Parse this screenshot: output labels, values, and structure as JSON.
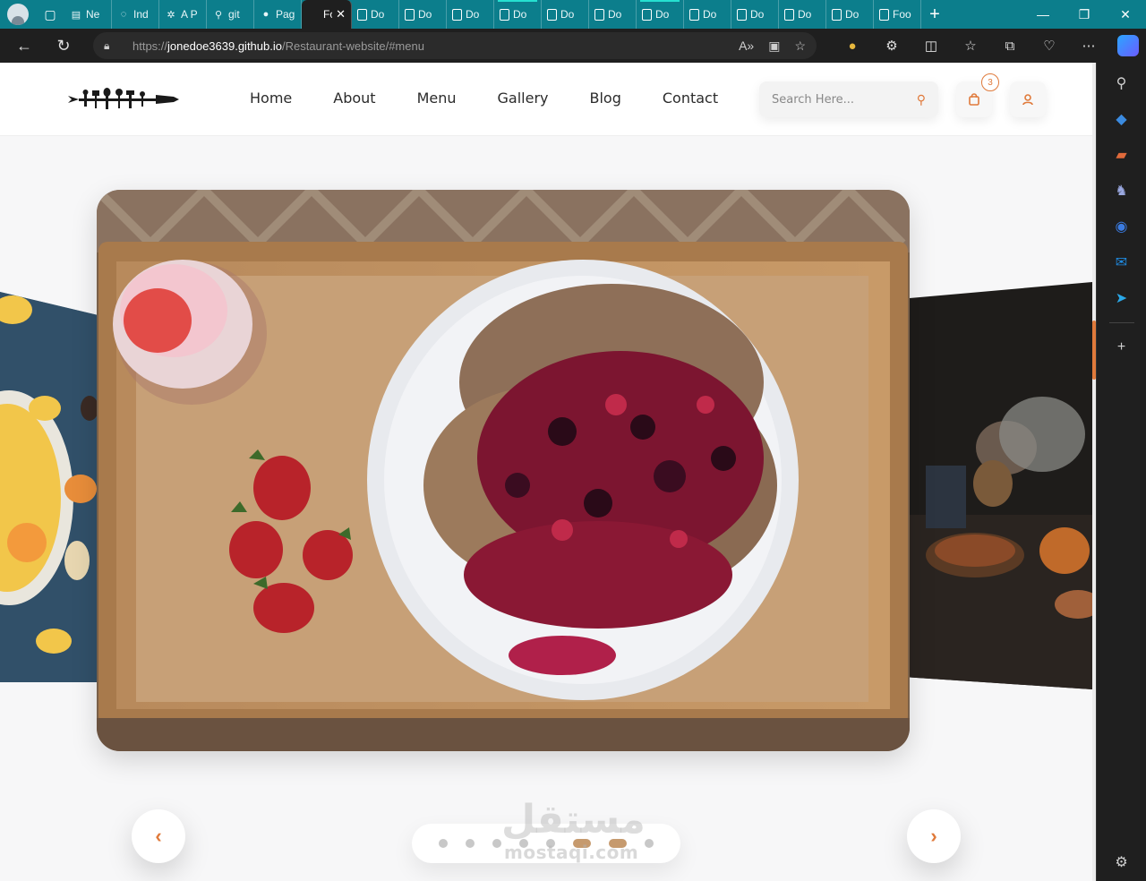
{
  "browser": {
    "tabs": [
      {
        "title": "Ne",
        "icon": "mail-icon"
      },
      {
        "title": "Ind",
        "icon": "globe-icon"
      },
      {
        "title": "A P",
        "icon": "chatgpt-icon"
      },
      {
        "title": "git",
        "icon": "search-icon"
      },
      {
        "title": "Pag",
        "icon": "github-icon"
      },
      {
        "title": "Foo",
        "icon": "page-icon",
        "active": true
      },
      {
        "title": "Do",
        "icon": "document-icon"
      },
      {
        "title": "Do",
        "icon": "document-icon"
      },
      {
        "title": "Do",
        "icon": "document-icon"
      },
      {
        "title": "Do",
        "icon": "document-icon"
      },
      {
        "title": "Do",
        "icon": "document-icon"
      },
      {
        "title": "Do",
        "icon": "document-icon"
      },
      {
        "title": "Do",
        "icon": "document-icon"
      },
      {
        "title": "Do",
        "icon": "document-icon"
      },
      {
        "title": "Do",
        "icon": "document-icon"
      },
      {
        "title": "Do",
        "icon": "document-icon"
      },
      {
        "title": "Do",
        "icon": "document-icon"
      },
      {
        "title": "Foo",
        "icon": "document-icon"
      }
    ],
    "url": {
      "protocol": "https://",
      "host": "jonedoe3639.github.io",
      "path": "/Restaurant-website/#menu"
    },
    "accent": "#0c7e8c"
  },
  "site": {
    "nav": [
      "Home",
      "About",
      "Menu",
      "Gallery",
      "Blog",
      "Contact"
    ],
    "search_placeholder": "Search Here...",
    "cart_count": "3",
    "accent": "#e07a3b"
  },
  "carousel": {
    "dot_count": 8,
    "active_dots": [
      5,
      6
    ]
  },
  "watermark": {
    "arabic": "مستقل",
    "latin": "mostaqi.com"
  }
}
